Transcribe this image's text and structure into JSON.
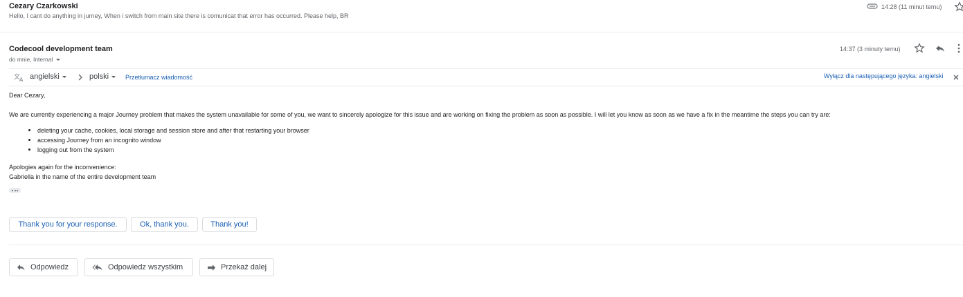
{
  "message1": {
    "sender": "Cezary Czarkowski",
    "snippet": "Hello, I cant do anything in jurney, When i switch from main site there is comunicat that error has occurred. Please help, BR",
    "time": "14:28 (11 minut temu)",
    "attachment_icon": "attachment-icon",
    "star_icon": "star-icon"
  },
  "message2": {
    "sender": "Codecool development team",
    "recipient": "do mnie, Internal",
    "time": "14:37 (3 minuty temu)",
    "icons": [
      "star-icon",
      "reply-icon",
      "more-vert-icon"
    ]
  },
  "translate_bar": {
    "source_lang": "angielski",
    "target_lang": "polski",
    "translate_link": "Przetłumacz wiadomość",
    "disable_link": "Wyłącz dla następującego języka: angielski",
    "icons": [
      "translate-icon",
      "chevron-right-icon",
      "close-icon"
    ]
  },
  "body": {
    "greeting": "Dear Cezary,",
    "paragraph": "We are currently experiencing a major Journey problem that makes the system unavailable for some of you, we want to sincerely apologize for this issue and are working on fixing the problem as soon as possible. I will let you know as soon as we have a fix in the meantime the steps you can try are:",
    "steps": [
      "deleting your cache, cookies, local storage and session store and after that restarting your browser",
      "accessing Journey from an incognito window",
      "logging out from the system"
    ],
    "closing1": "Apologies again for the inconvenience:",
    "closing2": "Gabriella in the name of the entire development team"
  },
  "smart_replies": [
    "Thank you for your response.",
    "Ok, thank you.",
    "Thank you!"
  ],
  "actions": {
    "reply": "Odpowiedz",
    "reply_all": "Odpowiedz wszystkim",
    "forward": "Przekaż dalej",
    "icons": [
      "reply-icon",
      "reply-all-icon",
      "forward-icon"
    ]
  },
  "colors": {
    "link": "#1a5fb4",
    "muted": "#5f6368",
    "border": "#dadce0"
  }
}
